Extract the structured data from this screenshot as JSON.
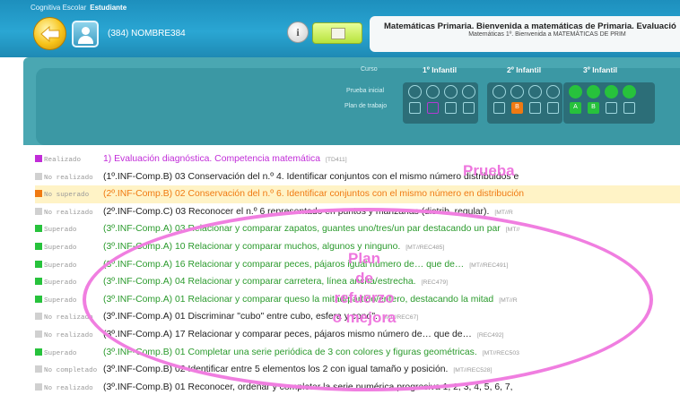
{
  "header": {
    "app_name": "Cognitiva Escolar",
    "app_role": "Estudiante",
    "user_label": "(384) NOMBRE384",
    "info_symbol": "i",
    "title": "Matemáticas Primaria. Bienvenida a matemáticas de Primaria. Evaluació",
    "subtitle": "Matemáticas 1º.   Bienvenida a MATEMÁTICAS DE PRIM"
  },
  "panel": {
    "course_label": "Curso",
    "initial_test_label": "Prueba inicial",
    "work_plan_label": "Plan de trabajo",
    "columns": [
      {
        "name": "1º Infantil",
        "circles": [
          "empty",
          "empty",
          "empty",
          "empty"
        ],
        "squares": [
          "empty",
          "purple",
          "empty",
          "empty"
        ],
        "square_labels": [
          "",
          "",
          "",
          ""
        ]
      },
      {
        "name": "2º Infantil",
        "circles": [
          "empty",
          "empty",
          "empty",
          "empty"
        ],
        "squares": [
          "empty",
          "orange",
          "empty",
          "empty"
        ],
        "square_labels": [
          "",
          "B",
          "",
          ""
        ]
      },
      {
        "name": "3º Infantil",
        "circles": [
          "green",
          "green",
          "green",
          "green"
        ],
        "squares": [
          "green",
          "green",
          "empty",
          "empty"
        ],
        "square_labels": [
          "A",
          "B",
          "",
          ""
        ]
      }
    ]
  },
  "rows": [
    {
      "status": "Realizado",
      "text": "1) Evaluación diagnóstica. Competencia matemática",
      "ref": "[TD411]",
      "color": "#c12cd8",
      "mark": "#c12cd8"
    },
    {
      "status": "No realizado",
      "text": "(1º.INF-Comp.B) 03 Conservación del n.º 4. Identificar conjuntos con el mismo número distribuidos e",
      "ref": "",
      "color": "#222222",
      "mark": "#d0d0d0"
    },
    {
      "status": "No superado",
      "text": "(2º.INF-Comp.B) 02 Conservación del n.º 6. Identificar conjuntos con el mismo número en distribución",
      "ref": "",
      "color": "#f07a12",
      "mark": "#f07a12",
      "current": true
    },
    {
      "status": "No realizado",
      "text": "(2º.INF-Comp.C) 03 Reconocer el n.º 6 representado en puntos y manzanas (distrib. regular).",
      "ref": "[MT//R",
      "color": "#222222",
      "mark": "#d0d0d0"
    },
    {
      "status": "Superado",
      "text": "(3º.INF-Comp.A) 03 Relacionar y comparar zapatos, guantes uno/tres/un par destacando un par",
      "ref": "[MT//",
      "color": "#2a9a2c",
      "mark": "#27c23c"
    },
    {
      "status": "Superado",
      "text": "(3º.INF-Comp.A) 10 Relacionar y comparar muchos, algunos y ninguno.",
      "ref": "[MT//REC485]",
      "color": "#2a9a2c",
      "mark": "#27c23c"
    },
    {
      "status": "Superado",
      "text": "(3º.INF-Comp.A) 16 Relacionar y comparar peces, pájaros igual número de… que de…",
      "ref": "[MT//REC491]",
      "color": "#2a9a2c",
      "mark": "#27c23c"
    },
    {
      "status": "Superado",
      "text": "(3º.INF-Comp.A) 04 Relacionar y comparar carretera, línea ancha/estrecha.",
      "ref": "[REC479]",
      "color": "#2a9a2c",
      "mark": "#27c23c"
    },
    {
      "status": "Superado",
      "text": "(3º.INF-Comp.A) 01 Relacionar y comparar queso la mitad/partido/entero, destacando la mitad",
      "ref": "[MT//R",
      "color": "#2a9a2c",
      "mark": "#27c23c"
    },
    {
      "status": "No realizado",
      "text": "(3º.INF-Comp.A) 01 Discriminar \"cubo\" entre cubo, esfera y cono\".",
      "ref": "[MT//REC67]",
      "color": "#222222",
      "mark": "#d0d0d0"
    },
    {
      "status": "No realizado",
      "text": "(3º.INF-Comp.A) 17 Relacionar y comparar peces, pájaros mismo número de… que de…",
      "ref": "[REC492]",
      "color": "#222222",
      "mark": "#d0d0d0"
    },
    {
      "status": "Superado",
      "text": "(3º.INF-Comp.B) 01 Completar una serie periódica de 3 con colores y figuras geométricas.",
      "ref": "[MT//REC503",
      "color": "#2a9a2c",
      "mark": "#27c23c"
    },
    {
      "status": "No completado",
      "text": "(3º.INF-Comp.B) 02 Identificar entre 5 elementos los 2 con igual tamaño y posición.",
      "ref": "[MT//REC528]",
      "color": "#222222",
      "mark": "#d0d0d0"
    },
    {
      "status": "No realizado",
      "text": "(3º.INF-Comp.B) 01 Reconocer, ordenar y completar la serie numérica progresiva 1, 2, 3, 4, 5, 6, 7,",
      "ref": "",
      "color": "#222222",
      "mark": "#d0d0d0"
    }
  ],
  "annotations": {
    "prueba": "Prueba",
    "plan_lines": [
      "Plan",
      "de",
      "refuerzo",
      "o mejora"
    ],
    "color": "#ee76de"
  }
}
